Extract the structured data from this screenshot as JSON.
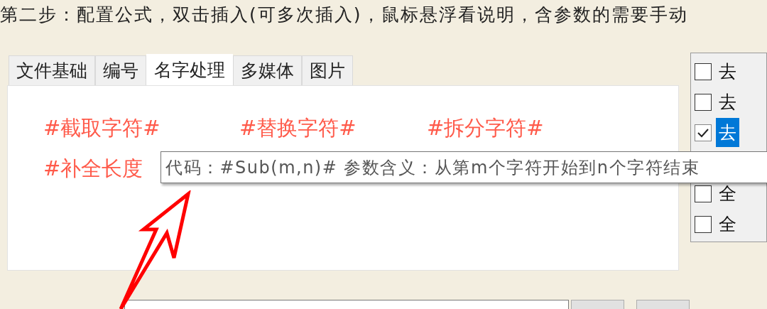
{
  "instruction": "第二步：配置公式，双击插入(可多次插入)，鼠标悬浮看说明，含参数的需要手动",
  "tabs": [
    {
      "label": "文件基础",
      "selected": false
    },
    {
      "label": "编号",
      "selected": false
    },
    {
      "label": "名字处理",
      "selected": true
    },
    {
      "label": "多媒体",
      "selected": false
    },
    {
      "label": "图片",
      "selected": false
    }
  ],
  "formulas": [
    "#截取字符#",
    "#替换字符#",
    "#拆分字符#",
    "#补全长度"
  ],
  "tooltip": "代码：#Sub(m,n)# 参数含义：从第m个字符开始到n个字符结束",
  "options": [
    {
      "label": "去",
      "checked": false,
      "selected": false
    },
    {
      "label": "去",
      "checked": false,
      "selected": false
    },
    {
      "label": "去",
      "checked": true,
      "selected": true
    },
    {
      "label": "全",
      "checked": false,
      "selected": false
    },
    {
      "label": "全",
      "checked": false,
      "selected": false
    }
  ]
}
